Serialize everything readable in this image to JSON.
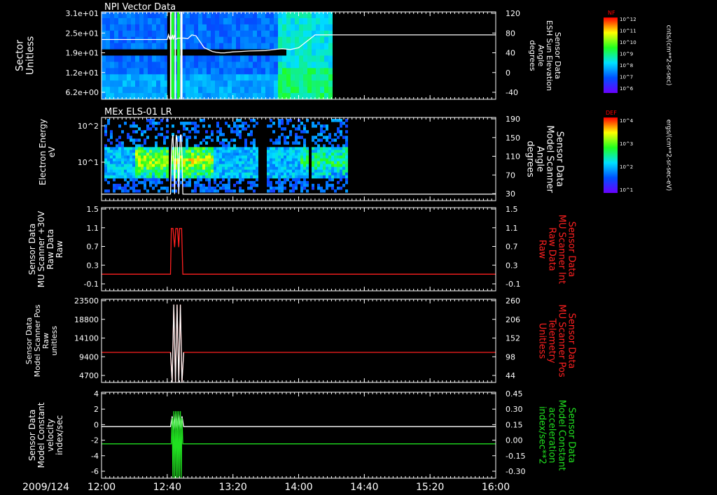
{
  "date_label": "2009/124",
  "x_ticks": [
    "12:00",
    "12:40",
    "13:20",
    "14:00",
    "14:40",
    "15:20",
    "16:00"
  ],
  "colors": {
    "white": "#ffffff",
    "red": "#ff2020",
    "green": "#20e020",
    "bg": "#000000"
  },
  "chart_data": [
    {
      "type": "heatmap",
      "title": "NPI Vector Data",
      "ylabel_lines": [
        "Sector",
        "Unitless"
      ],
      "y_ticks": [
        "3.1e+01",
        "2.5e+01",
        "1.9e+01",
        "1.2e+01",
        "6.2e+00"
      ],
      "y2label_lines": [
        "Sensor Data",
        "ESH Sun Elevation",
        "Angle",
        "degrees"
      ],
      "y2_ticks": [
        "120",
        "80",
        "40",
        "0",
        "-40"
      ],
      "y2lim": [
        -70,
        120
      ],
      "overlay_line": {
        "x_minutes": [
          0,
          160,
          163,
          166,
          168,
          170,
          173,
          175,
          178,
          180,
          186,
          190,
          196,
          200,
          210,
          220,
          230,
          240,
          250,
          260,
          270,
          280,
          290,
          300,
          310,
          320,
          340,
          360,
          400,
          420,
          440,
          460,
          480,
          520,
          560,
          600,
          640,
          680,
          720,
          760,
          800,
          840,
          960
        ],
        "y": [
          60,
          60,
          70,
          60,
          70,
          60,
          70,
          60,
          70,
          60,
          63,
          63,
          63,
          63,
          62,
          70,
          68,
          55,
          42,
          38,
          34,
          32,
          31,
          31,
          32,
          33,
          34,
          35,
          36,
          38,
          40,
          38,
          42,
          70,
          70,
          70,
          70,
          70,
          70,
          70,
          70,
          70,
          70
        ]
      },
      "colorbar": {
        "label": "NF",
        "units": "cnts/(cm**2-sr-sec)",
        "ticks": [
          "10^12",
          "10^11",
          "10^10",
          "10^9",
          "10^8",
          "10^7",
          "10^6"
        ]
      }
    },
    {
      "type": "heatmap",
      "title": "MEx ELS-01 LR",
      "ylabel_lines": [
        "Electron Energy",
        "eV"
      ],
      "y_ticks": [
        "10^2",
        "10^1"
      ],
      "y2label_lines": [
        "Sensor Data",
        "Model Scanner",
        "Angle",
        "degrees"
      ],
      "y2_ticks": [
        "190",
        "150",
        "110",
        "70",
        "30"
      ],
      "y2lim": [
        0,
        190
      ],
      "colorbar": {
        "label": "DEF",
        "units": "ergs/(cm**2-sr-sec-eV)",
        "ticks": [
          "10^4",
          "10^3",
          "10^2",
          "10^1"
        ]
      }
    },
    {
      "type": "line",
      "ylabel_lines": [
        "Sensor Data",
        "MU Scanner +30V",
        "Raw Data",
        "Raw"
      ],
      "y_ticks": [
        "1.5",
        "1.1",
        "0.7",
        "0.3",
        "-0.1"
      ],
      "ylim": [
        -0.5,
        1.5
      ],
      "y2label_lines": [
        "Sensor Data",
        "MU Scanner Int",
        "Raw Data",
        "Raw"
      ],
      "y2_ticks": [
        "1.5",
        "1.1",
        "0.7",
        "0.3",
        "-0.1"
      ],
      "series": [
        {
          "color": "#ff2020",
          "x_minutes": [
            0,
            168,
            170,
            174,
            178,
            181,
            185,
            188,
            190,
            195,
            198,
            960
          ],
          "y": [
            -0.1,
            -0.1,
            1.0,
            1.0,
            0.55,
            1.0,
            1.0,
            0.55,
            1.0,
            1.0,
            -0.1,
            -0.1
          ]
        }
      ]
    },
    {
      "type": "line",
      "ylabel_lines": [
        "Sensor Data",
        "Model Scanner Pos",
        "Raw",
        "unitless"
      ],
      "y_ticks": [
        "23500",
        "18800",
        "14100",
        "9400",
        "4700"
      ],
      "ylim": [
        0,
        23500
      ],
      "y2label_lines": [
        "Sensor Data",
        "MU Scanner Pos",
        "Telemetry",
        "Unitless"
      ],
      "y2_ticks": [
        "260",
        "206",
        "152",
        "98",
        "44"
      ],
      "series": [
        {
          "color": "#ff2020",
          "x_minutes": [
            0,
            168,
            172,
            176,
            180,
            184,
            188,
            192,
            196,
            200,
            960
          ],
          "y": [
            8500,
            8500,
            0,
            22000,
            0,
            22000,
            0,
            22000,
            0,
            8500,
            8500
          ]
        },
        {
          "color": "#ffffff",
          "x_minutes": [
            168,
            172,
            176,
            180,
            184,
            188,
            192,
            196,
            200
          ],
          "y": [
            8500,
            0,
            22000,
            0,
            22000,
            0,
            22000,
            0,
            8500
          ]
        }
      ]
    },
    {
      "type": "line",
      "ylabel_lines": [
        "Sensor Data",
        "Model Constant",
        "velocity",
        "index/sec"
      ],
      "y_ticks": [
        "4",
        "2",
        "0",
        "-2",
        "-4",
        "-6"
      ],
      "ylim": [
        -6,
        4
      ],
      "y2label_lines": [
        "Sensor Data",
        "Model Constant",
        "acceleration",
        "index/sec**2"
      ],
      "y2_ticks": [
        "0.45",
        "0.30",
        "0.15",
        "0.00",
        "-0.15",
        "-0.30"
      ],
      "series": [
        {
          "color": "#ffffff",
          "x_minutes": [
            0,
            168,
            172,
            176,
            180,
            184,
            188,
            192,
            196,
            200,
            960
          ],
          "y": [
            0,
            0,
            1.2,
            -0.5,
            1.5,
            -0.5,
            1.5,
            -0.5,
            1.2,
            0,
            0
          ]
        },
        {
          "color": "#20e020",
          "x_minutes": [
            0,
            170,
            172,
            174,
            176,
            178,
            180,
            182,
            184,
            186,
            188,
            190,
            192,
            194,
            196,
            198,
            960
          ],
          "y": [
            -2,
            -2,
            1,
            -6,
            1.8,
            -6,
            1.8,
            -6,
            1.8,
            -6,
            1.8,
            -6,
            1.8,
            -6,
            1,
            -2,
            -2
          ]
        }
      ]
    }
  ]
}
